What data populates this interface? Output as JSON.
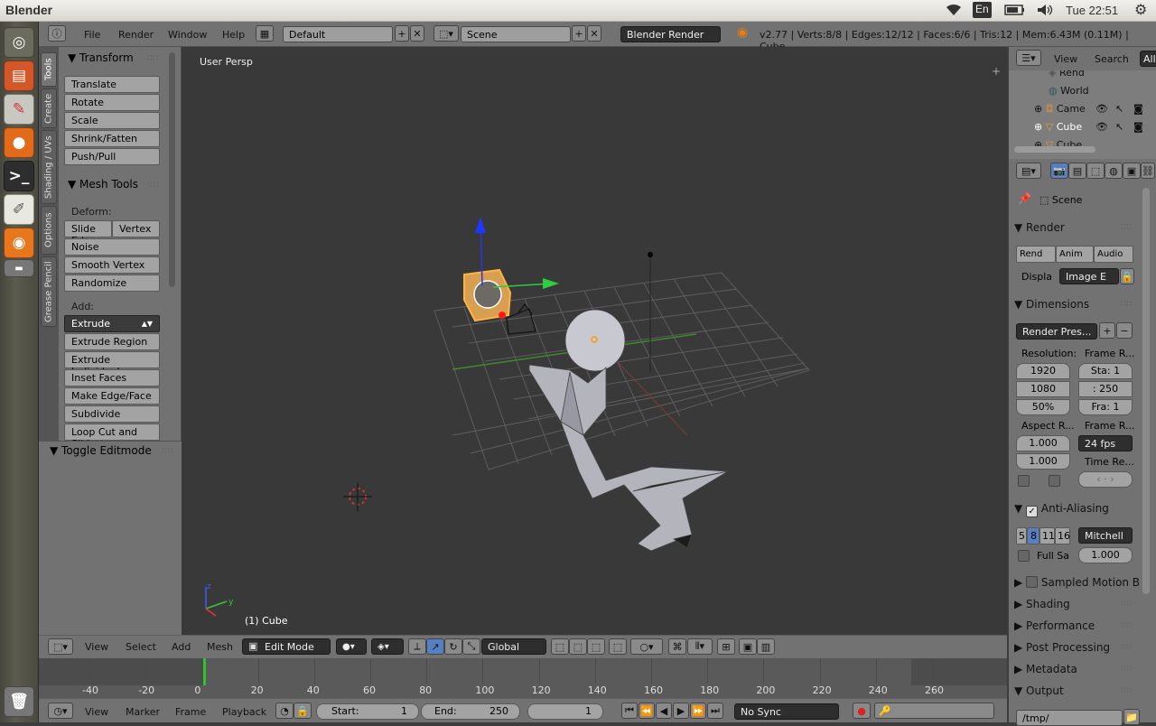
{
  "top_bar": {
    "app_title": "Blender",
    "keyboard": "En",
    "clock": "Tue 22:51"
  },
  "info_header": {
    "menus": [
      "File",
      "Render",
      "Window",
      "Help"
    ],
    "screen_layout": "Default",
    "scene": "Scene",
    "render_engine": "Blender Render",
    "stats": "v2.77 | Verts:8/8 | Edges:12/12 | Faces:6/6 | Tris:12 | Mem:6.43M (0.11M) | Cube"
  },
  "tool_tabs": [
    "Tools",
    "Create",
    "Shading / UVs",
    "Options",
    "Grease Pencil"
  ],
  "tool_shelf": {
    "transform_title": "Transform",
    "transform_buttons": [
      "Translate",
      "Rotate",
      "Scale",
      "Shrink/Fatten",
      "Push/Pull"
    ],
    "mesh_tools_title": "Mesh Tools",
    "deform_label": "Deform:",
    "slide_edge": "Slide Ed",
    "vertex": "Vertex",
    "deform_buttons": [
      "Noise",
      "Smooth Vertex",
      "Randomize"
    ],
    "add_label": "Add:",
    "extrude": "Extrude",
    "add_buttons": [
      "Extrude Region",
      "Extrude Individual",
      "Inset Faces",
      "Make Edge/Face",
      "Subdivide",
      "Loop Cut and Slide"
    ],
    "toggle_editmode": "Toggle Editmode"
  },
  "viewport": {
    "view_name": "User Persp",
    "object_info": "(1) Cube"
  },
  "view_header": {
    "menus": [
      "View",
      "Select",
      "Add",
      "Mesh"
    ],
    "mode": "Edit Mode",
    "orientation": "Global"
  },
  "timeline": {
    "ruler": [
      "-40",
      "-20",
      "0",
      "20",
      "40",
      "60",
      "80",
      "100",
      "120",
      "140",
      "160",
      "180",
      "200",
      "220",
      "240",
      "260"
    ],
    "current_frame_value": 0,
    "menus": [
      "View",
      "Marker",
      "Frame",
      "Playback"
    ],
    "start_label": "Start:",
    "start_value": "1",
    "end_label": "End:",
    "end_value": "250",
    "current_frame": "1",
    "sync": "No Sync"
  },
  "outliner": {
    "menus": [
      "View",
      "Search",
      "All"
    ],
    "items": [
      "Rend",
      "World",
      "Came",
      "Cube",
      "Cube"
    ]
  },
  "properties": {
    "scene": "Scene",
    "render_title": "Render",
    "render_buttons": [
      "Rend",
      "Anim",
      "Audio"
    ],
    "display_label": "Displa",
    "display_value": "Image E",
    "dimensions_title": "Dimensions",
    "render_presets": "Render Pres...",
    "resolution_label": "Resolution:",
    "res_x": "1920",
    "res_y": "1080",
    "res_pct": "50%",
    "frame_range_label": "Frame R...",
    "start": "Sta: 1",
    "end": ": 250",
    "step": "Fra: 1",
    "aspect_label": "Aspect R...",
    "aspect_x": "1.000",
    "aspect_y": "1.000",
    "frame_rate_label": "Frame R...",
    "fps": "24 fps",
    "time_remap_label": "Time Re...",
    "antialias_title": "Anti-Aliasing",
    "aa_samples": [
      "5",
      "8",
      "11",
      "16"
    ],
    "aa_filter": "Mitchell",
    "full_sample": "Full Sa",
    "filter_size": "1.000",
    "sampled_motion": "Sampled Motion B",
    "collapsed_sections": [
      "Shading",
      "Performance",
      "Post Processing",
      "Metadata"
    ],
    "output_title": "Output",
    "output_path": "/tmp/"
  }
}
